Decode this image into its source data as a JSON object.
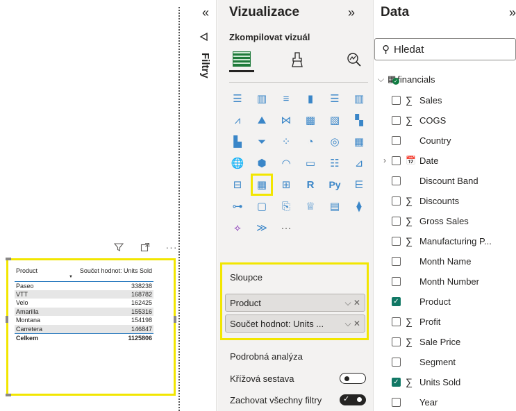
{
  "table_visual": {
    "headers": [
      "Product",
      "Součet hodnot: Units Sold"
    ],
    "rows": [
      {
        "product": "Paseo",
        "units": "338238"
      },
      {
        "product": "VTT",
        "units": "168782"
      },
      {
        "product": "Velo",
        "units": "162425"
      },
      {
        "product": "Amarilla",
        "units": "155316"
      },
      {
        "product": "Montana",
        "units": "154198"
      },
      {
        "product": "Carretera",
        "units": "146847"
      }
    ],
    "total_label": "Celkem",
    "total_value": "1125806",
    "header_icons": [
      "filter-icon",
      "focus-mode-icon",
      "more-options-icon"
    ]
  },
  "filters": {
    "label": "Filtry",
    "collapse_glyph": "«"
  },
  "visualizations": {
    "title": "Vizualizace",
    "expand_glyph": "»",
    "subtitle": "Zkompilovat vizuál",
    "wells_title": "Sloupce",
    "wells": [
      {
        "label": "Product",
        "controls": "⌵ ✕"
      },
      {
        "label": "Součet hodnot: Units ...",
        "controls": "⌵ ✕"
      }
    ],
    "drill_title": "Podrobná analýza",
    "toggles": [
      {
        "label": "Křížová sestava",
        "state": "off"
      },
      {
        "label": "Zachovat všechny filtry",
        "state": "on"
      }
    ],
    "more_glyph": "···"
  },
  "data": {
    "title": "Data",
    "expand_glyph": "»",
    "search_placeholder": "Hledat",
    "table_name": "financials",
    "fields": [
      {
        "label": "Sales",
        "sigma": true,
        "checked": false
      },
      {
        "label": "COGS",
        "sigma": true,
        "checked": false
      },
      {
        "label": "Country",
        "sigma": false,
        "checked": false
      },
      {
        "label": "Date",
        "sigma": false,
        "checked": false,
        "calendar": true,
        "expandable": true
      },
      {
        "label": "Discount Band",
        "sigma": false,
        "checked": false
      },
      {
        "label": "Discounts",
        "sigma": true,
        "checked": false
      },
      {
        "label": "Gross Sales",
        "sigma": true,
        "checked": false
      },
      {
        "label": "Manufacturing P...",
        "sigma": true,
        "checked": false
      },
      {
        "label": "Month Name",
        "sigma": false,
        "checked": false
      },
      {
        "label": "Month Number",
        "sigma": false,
        "checked": false
      },
      {
        "label": "Product",
        "sigma": false,
        "checked": true
      },
      {
        "label": "Profit",
        "sigma": true,
        "checked": false
      },
      {
        "label": "Sale Price",
        "sigma": true,
        "checked": false
      },
      {
        "label": "Segment",
        "sigma": false,
        "checked": false
      },
      {
        "label": "Units Sold",
        "sigma": true,
        "checked": true
      },
      {
        "label": "Year",
        "sigma": false,
        "checked": false
      }
    ]
  },
  "colors": {
    "highlight": "#f2e600",
    "accent": "#117865",
    "pane_bg": "#f3f2f1"
  }
}
